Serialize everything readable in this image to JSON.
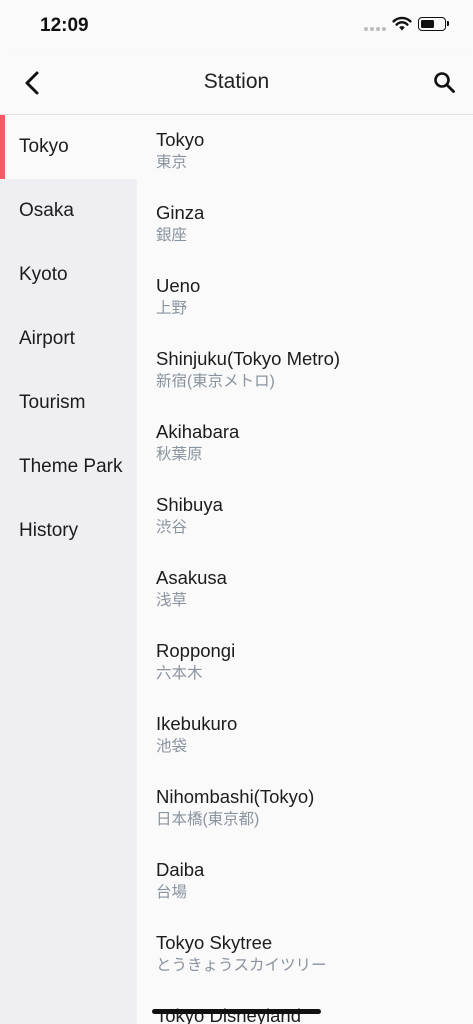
{
  "status_bar": {
    "time": "12:09"
  },
  "nav": {
    "title": "Station"
  },
  "sidebar": {
    "items": [
      {
        "label": "Tokyo",
        "active": true
      },
      {
        "label": "Osaka"
      },
      {
        "label": "Kyoto"
      },
      {
        "label": "Airport"
      },
      {
        "label": "Tourism"
      },
      {
        "label": "Theme Park"
      },
      {
        "label": "History"
      }
    ]
  },
  "stations": [
    {
      "name": "Tokyo",
      "sub": "東京"
    },
    {
      "name": "Ginza",
      "sub": "銀座"
    },
    {
      "name": "Ueno",
      "sub": "上野"
    },
    {
      "name": "Shinjuku(Tokyo Metro)",
      "sub": "新宿(東京メトロ)"
    },
    {
      "name": "Akihabara",
      "sub": "秋葉原"
    },
    {
      "name": "Shibuya",
      "sub": "渋谷"
    },
    {
      "name": "Asakusa",
      "sub": "浅草"
    },
    {
      "name": "Roppongi",
      "sub": "六本木"
    },
    {
      "name": "Ikebukuro",
      "sub": "池袋"
    },
    {
      "name": "Nihombashi(Tokyo)",
      "sub": "日本橋(東京都)"
    },
    {
      "name": "Daiba",
      "sub": "台場"
    },
    {
      "name": "Tokyo Skytree",
      "sub": "とうきょうスカイツリー"
    },
    {
      "name": "Tokyo Disneyland",
      "sub": ""
    }
  ],
  "colors": {
    "accent": "#f25c64",
    "sidebar_bg": "#efeef3",
    "subtext": "#8a93a0"
  },
  "icons": {
    "back": "chevron-left-icon",
    "search": "search-icon",
    "wifi": "wifi-icon",
    "battery": "battery-icon"
  }
}
